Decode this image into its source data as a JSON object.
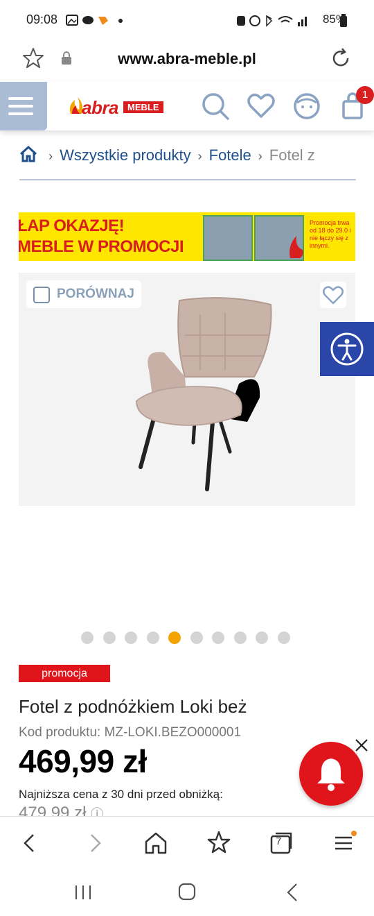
{
  "status_bar": {
    "time": "09:08",
    "battery": "85%"
  },
  "browser": {
    "url": "www.abra-meble.pl",
    "tabs_count": "7"
  },
  "header": {
    "logo_text": "abra",
    "logo_badge": "MEBLE",
    "cart_count": "1"
  },
  "breadcrumb": {
    "items": [
      "Wszystkie produkty",
      "Fotele",
      "Fotel z"
    ]
  },
  "banner": {
    "line1": "ŁAP OKAZJĘ!",
    "line2": "MEBLE W PROMOCJI",
    "note": "Promocja trwa od 18 do 29.0 i nie łączy się z innymi."
  },
  "gallery": {
    "compare_label": "PORÓWNAJ",
    "dots_total": 10,
    "active_dot": 5
  },
  "product": {
    "badge": "promocja",
    "title": "Fotel z podnóżkiem Loki beż",
    "code": "Kod produktu: MZ-LOKI.BEZO000001",
    "price": "469,99 zł",
    "lowest_label": "Najniższa cena z 30 dni przed obniżką:",
    "old_price": "479,99 zł"
  },
  "colors": {
    "brand_red": "#d81e1e",
    "link_blue": "#1e4f8c",
    "dot_active": "#f5a300",
    "promo_red": "#e0151b"
  }
}
